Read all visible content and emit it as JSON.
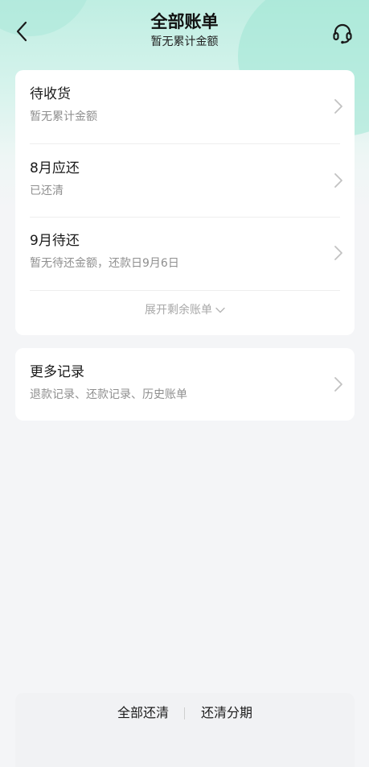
{
  "header": {
    "title": "全部账单",
    "subtitle": "暂无累计金额",
    "back_icon": "chevron-left-icon",
    "service_icon": "headset-icon"
  },
  "bills": {
    "items": [
      {
        "title": "待收货",
        "subtitle": "暂无累计金额"
      },
      {
        "title": "8月应还",
        "subtitle": "已还清"
      },
      {
        "title": "9月待还",
        "subtitle": "暂无待还金额，还款日9月6日"
      }
    ],
    "expand_label": "展开剩余账单"
  },
  "more": {
    "title": "更多记录",
    "subtitle": "退款记录、还款记录、历史账单"
  },
  "footer": {
    "pay_all_label": "全部还清",
    "installment_label": "还清分期"
  },
  "colors": {
    "accent_bg": "#bfeee2",
    "page_bg": "#f4f5f7",
    "card_bg": "#ffffff",
    "muted_text": "#8f8f8f"
  }
}
